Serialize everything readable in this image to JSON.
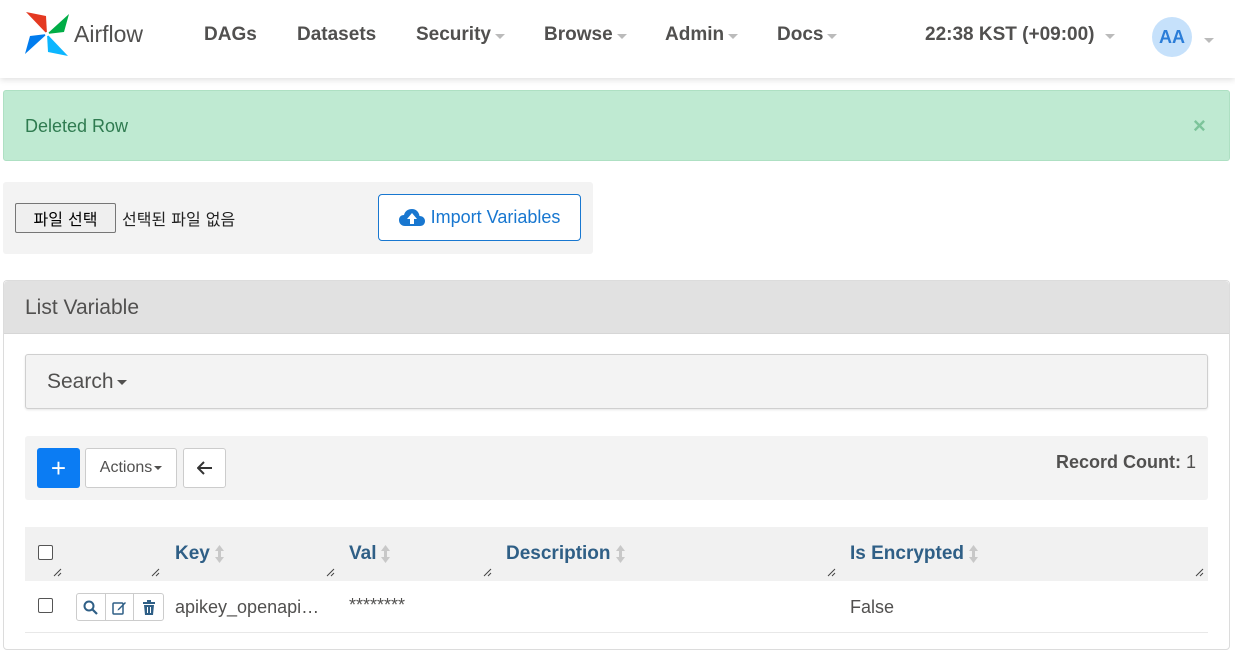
{
  "nav": {
    "brand": "Airflow",
    "items": [
      {
        "label": "DAGs",
        "dropdown": false
      },
      {
        "label": "Datasets",
        "dropdown": false
      },
      {
        "label": "Security",
        "dropdown": true
      },
      {
        "label": "Browse",
        "dropdown": true
      },
      {
        "label": "Admin",
        "dropdown": true
      },
      {
        "label": "Docs",
        "dropdown": true
      }
    ],
    "time": "22:38 KST (+09:00)",
    "avatar": "AA"
  },
  "alert": {
    "message": "Deleted Row",
    "close": "×",
    "color": "#bfead2"
  },
  "import": {
    "file_button": "파일 선택",
    "file_status": "선택된 파일 없음",
    "button": "Import Variables"
  },
  "panel": {
    "title": "List Variable",
    "search_label": "Search",
    "actions_label": "Actions",
    "add_label": "+",
    "record_count_label": "Record Count:",
    "record_count": "1"
  },
  "table": {
    "columns": [
      "Key",
      "Val",
      "Description",
      "Is Encrypted"
    ],
    "rows": [
      {
        "key": "apikey_openapi…",
        "val": "********",
        "description": "",
        "is_encrypted": "False"
      }
    ]
  },
  "colors": {
    "primary": "#0b7cf3",
    "header_text": "#2f5f86",
    "success_bg": "#bfead2"
  }
}
